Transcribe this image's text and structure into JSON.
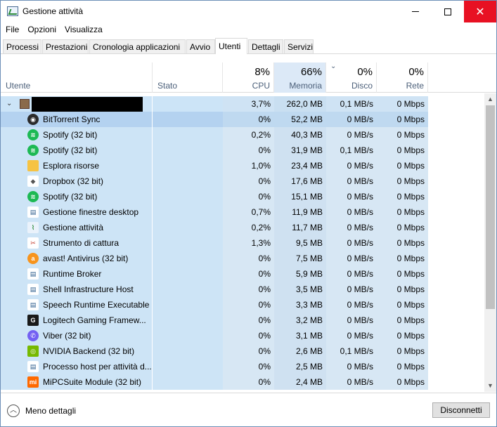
{
  "window": {
    "title": "Gestione attività"
  },
  "menu": [
    "File",
    "Opzioni",
    "Visualizza"
  ],
  "tabs": [
    "Processi",
    "Prestazioni",
    "Cronologia applicazioni",
    "Avvio",
    "Utenti",
    "Dettagli",
    "Servizi"
  ],
  "active_tab": "Utenti",
  "columns": {
    "user": "Utente",
    "status": "Stato",
    "cpu": {
      "label": "CPU",
      "total": "8%"
    },
    "memory": {
      "label": "Memoria",
      "total": "66%"
    },
    "disk": {
      "label": "Disco",
      "total": "0%"
    },
    "network": {
      "label": "Rete",
      "total": "0%"
    }
  },
  "user_row": {
    "cpu": "3,7%",
    "memory": "262,0 MB",
    "disk": "0,1 MB/s",
    "network": "0 Mbps"
  },
  "processes": [
    {
      "name": "BitTorrent Sync",
      "icon": "bittorrent-sync-icon",
      "cpu": "0%",
      "memory": "52,2 MB",
      "disk": "0 MB/s",
      "network": "0 Mbps"
    },
    {
      "name": "Spotify (32 bit)",
      "icon": "spotify-icon",
      "cpu": "0,2%",
      "memory": "40,3 MB",
      "disk": "0 MB/s",
      "network": "0 Mbps"
    },
    {
      "name": "Spotify (32 bit)",
      "icon": "spotify-icon",
      "cpu": "0%",
      "memory": "31,9 MB",
      "disk": "0,1 MB/s",
      "network": "0 Mbps"
    },
    {
      "name": "Esplora risorse",
      "icon": "folder-icon",
      "cpu": "1,0%",
      "memory": "23,4 MB",
      "disk": "0 MB/s",
      "network": "0 Mbps"
    },
    {
      "name": "Dropbox (32 bit)",
      "icon": "dropbox-icon",
      "cpu": "0%",
      "memory": "17,6 MB",
      "disk": "0 MB/s",
      "network": "0 Mbps"
    },
    {
      "name": "Spotify (32 bit)",
      "icon": "spotify-icon",
      "cpu": "0%",
      "memory": "15,1 MB",
      "disk": "0 MB/s",
      "network": "0 Mbps"
    },
    {
      "name": "Gestione finestre desktop",
      "icon": "window-app-icon",
      "cpu": "0,7%",
      "memory": "11,9 MB",
      "disk": "0 MB/s",
      "network": "0 Mbps"
    },
    {
      "name": "Gestione attività",
      "icon": "task-manager-icon",
      "cpu": "0,2%",
      "memory": "11,7 MB",
      "disk": "0 MB/s",
      "network": "0 Mbps"
    },
    {
      "name": "Strumento di cattura",
      "icon": "snipping-tool-icon",
      "cpu": "1,3%",
      "memory": "9,5 MB",
      "disk": "0 MB/s",
      "network": "0 Mbps"
    },
    {
      "name": "avast! Antivirus (32 bit)",
      "icon": "avast-icon",
      "cpu": "0%",
      "memory": "7,5 MB",
      "disk": "0 MB/s",
      "network": "0 Mbps"
    },
    {
      "name": "Runtime Broker",
      "icon": "window-app-icon",
      "cpu": "0%",
      "memory": "5,9 MB",
      "disk": "0 MB/s",
      "network": "0 Mbps"
    },
    {
      "name": "Shell Infrastructure Host",
      "icon": "window-app-icon",
      "cpu": "0%",
      "memory": "3,5 MB",
      "disk": "0 MB/s",
      "network": "0 Mbps"
    },
    {
      "name": "Speech Runtime Executable",
      "icon": "window-app-icon",
      "cpu": "0%",
      "memory": "3,3 MB",
      "disk": "0 MB/s",
      "network": "0 Mbps"
    },
    {
      "name": "Logitech Gaming Framew...",
      "icon": "logitech-icon",
      "cpu": "0%",
      "memory": "3,2 MB",
      "disk": "0 MB/s",
      "network": "0 Mbps"
    },
    {
      "name": "Viber (32 bit)",
      "icon": "viber-icon",
      "cpu": "0%",
      "memory": "3,1 MB",
      "disk": "0 MB/s",
      "network": "0 Mbps"
    },
    {
      "name": "NVIDIA Backend (32 bit)",
      "icon": "nvidia-icon",
      "cpu": "0%",
      "memory": "2,6 MB",
      "disk": "0,1 MB/s",
      "network": "0 Mbps"
    },
    {
      "name": "Processo host per attività d...",
      "icon": "window-app-icon",
      "cpu": "0%",
      "memory": "2,5 MB",
      "disk": "0 MB/s",
      "network": "0 Mbps"
    },
    {
      "name": "MiPCSuite Module (32 bit)",
      "icon": "mi-icon",
      "cpu": "0%",
      "memory": "2,4 MB",
      "disk": "0 MB/s",
      "network": "0 Mbps"
    }
  ],
  "footer": {
    "less_details": "Meno dettagli",
    "disconnect": "Disconnetti"
  }
}
